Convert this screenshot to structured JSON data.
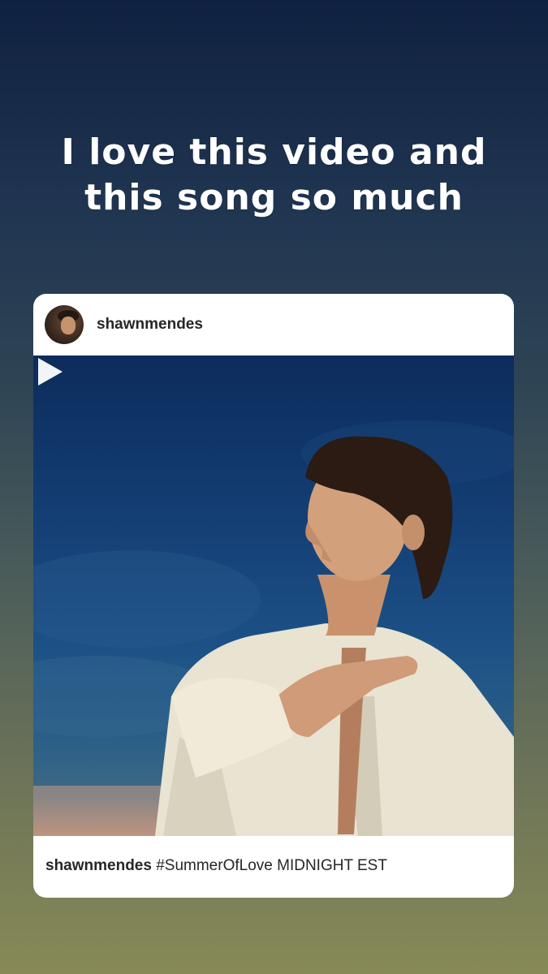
{
  "story": {
    "text_line1": "I love this video and",
    "text_line2": "this song so much"
  },
  "post": {
    "username": "shawnmendes",
    "caption_user": "shawnmendes",
    "caption_text": "#SummerOfLove MIDNIGHT EST",
    "media_type": "video",
    "play_icon": "play-icon"
  },
  "colors": {
    "bg_top": "#0f2140",
    "bg_bottom": "#878a56",
    "card": "#ffffff",
    "text_dark": "#262626"
  }
}
